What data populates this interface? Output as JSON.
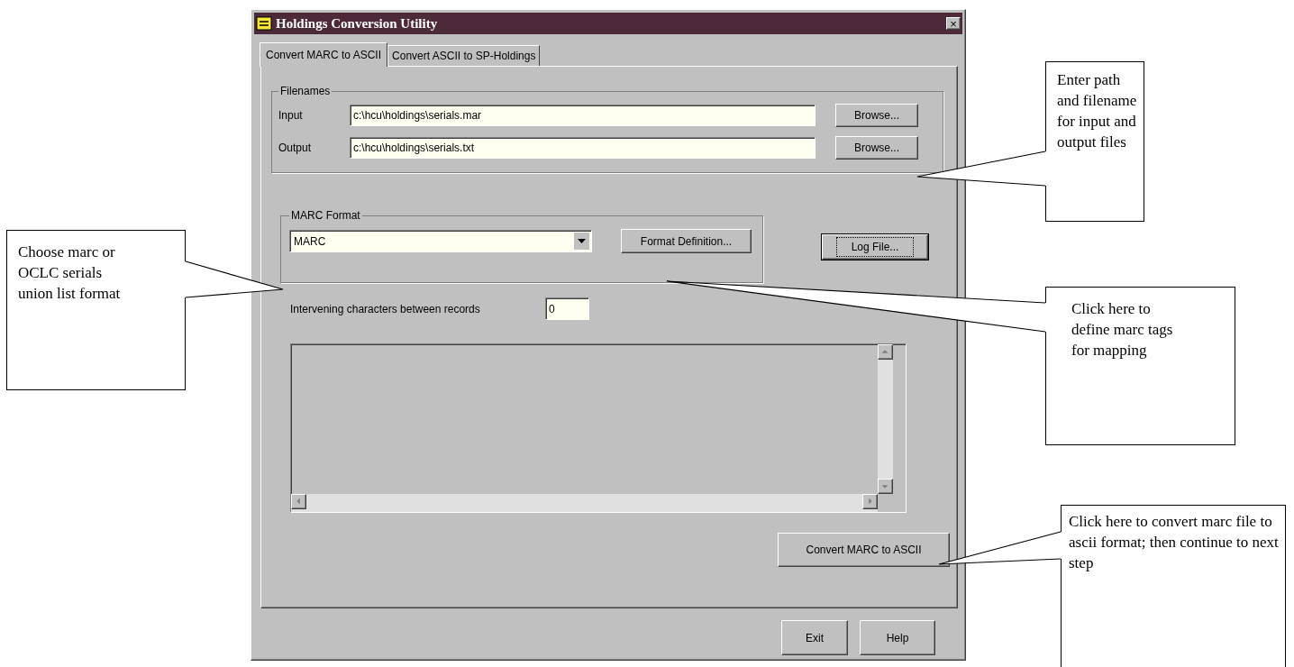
{
  "window": {
    "title": "Holdings Conversion Utility",
    "close": "×"
  },
  "tabs": [
    {
      "label": "Convert MARC to ASCII",
      "selected": true
    },
    {
      "label": "Convert ASCII to SP-Holdings",
      "selected": false
    }
  ],
  "filenames": {
    "legend": "Filenames",
    "rows": [
      {
        "label": "Input",
        "value": "c:\\hcu\\holdings\\serials.mar",
        "button": "Browse..."
      },
      {
        "label": "Output",
        "value": "c:\\hcu\\holdings\\serials.txt",
        "button": "Browse..."
      }
    ]
  },
  "marc_format": {
    "legend": "MARC Format",
    "value": "MARC",
    "button": "Format Definition..."
  },
  "log_file_button": {
    "label": "Log File...",
    "focused": true
  },
  "intervening": {
    "label": "Intervening characters between records",
    "value": "0"
  },
  "convert_button": "Convert MARC to ASCII",
  "footer_buttons": [
    "Exit",
    "Help"
  ],
  "callouts": [
    {
      "text": "Enter path and filename for input and output files"
    },
    {
      "text": "Choose marc or OCLC serials union list format"
    },
    {
      "text": "Click here to define marc tags for mapping"
    },
    {
      "text": "Click here to convert marc file to ascii format; then continue to next step"
    }
  ]
}
